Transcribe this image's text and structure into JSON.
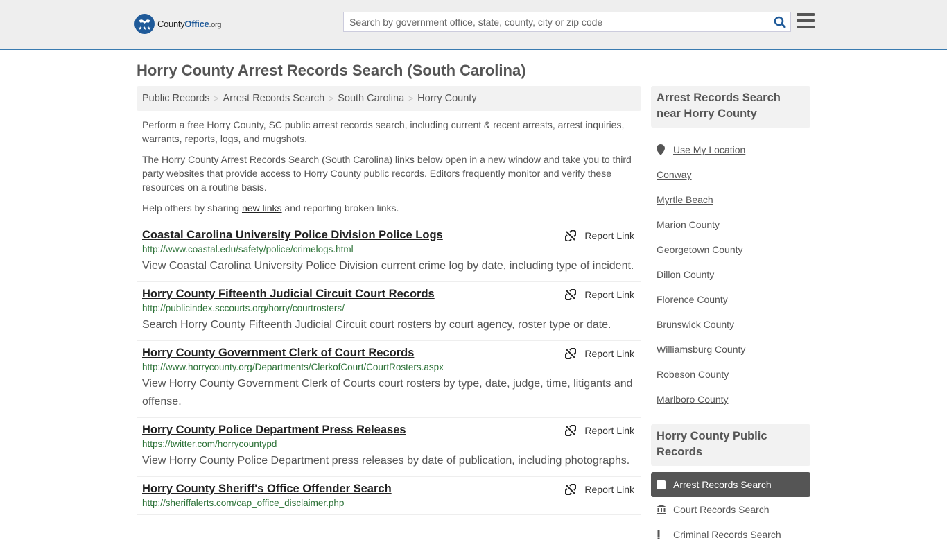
{
  "header": {
    "logo": {
      "county": "County",
      "office": "Office",
      "tld": ".org"
    },
    "search_placeholder": "Search by government office, state, county, city or zip code",
    "search_value": ""
  },
  "page_title": "Horry County Arrest Records Search (South Carolina)",
  "breadcrumb": [
    "Public Records",
    "Arrest Records Search",
    "South Carolina",
    "Horry County"
  ],
  "intro": {
    "p1": "Perform a free Horry County, SC public arrest records search, including current & recent arrests, arrest inquiries, warrants, reports, logs, and mugshots.",
    "p2": "The Horry County Arrest Records Search (South Carolina) links below open in a new window and take you to third party websites that provide access to Horry County public records. Editors frequently monitor and verify these resources on a routine basis.",
    "p3_before": "Help others by sharing ",
    "p3_link": "new links",
    "p3_after": " and reporting broken links."
  },
  "report_label": "Report Link",
  "results": [
    {
      "title": "Coastal Carolina University Police Division Police Logs",
      "url": "http://www.coastal.edu/safety/police/crimelogs.html",
      "desc": "View Coastal Carolina University Police Division current crime log by date, including type of incident."
    },
    {
      "title": "Horry County Fifteenth Judicial Circuit Court Records",
      "url": "http://publicindex.sccourts.org/horry/courtrosters/",
      "desc": "Search Horry County Fifteenth Judicial Circuit court rosters by court agency, roster type or date."
    },
    {
      "title": "Horry County Government Clerk of Court Records",
      "url": "http://www.horrycounty.org/Departments/ClerkofCourt/CourtRosters.aspx",
      "desc": "View Horry County Government Clerk of Courts court rosters by type, date, judge, time, litigants and offense."
    },
    {
      "title": "Horry County Police Department Press Releases",
      "url": "https://twitter.com/horrycountypd",
      "desc": "View Horry County Police Department press releases by date of publication, including photographs."
    },
    {
      "title": "Horry County Sheriff's Office Offender Search",
      "url": "http://sheriffalerts.com/cap_office_disclaimer.php",
      "desc": ""
    }
  ],
  "sidebar": {
    "nearby_heading": "Arrest Records Search near Horry County",
    "use_location": "Use My Location",
    "nearby": [
      "Conway",
      "Myrtle Beach",
      "Marion County",
      "Georgetown County",
      "Dillon County",
      "Florence County",
      "Brunswick County",
      "Williamsburg County",
      "Robeson County",
      "Marlboro County"
    ],
    "public_heading": "Horry County Public Records",
    "public_records": [
      {
        "label": "Arrest Records Search",
        "icon": "square-icon",
        "active": true
      },
      {
        "label": "Court Records Search",
        "icon": "courthouse-icon",
        "active": false
      },
      {
        "label": "Criminal Records Search",
        "icon": "exclamation-icon",
        "active": false
      }
    ]
  },
  "colors": {
    "accent": "#3a7bb0",
    "brand": "#1f5a99",
    "url_green": "#2b7136",
    "active_bg": "#555555"
  }
}
